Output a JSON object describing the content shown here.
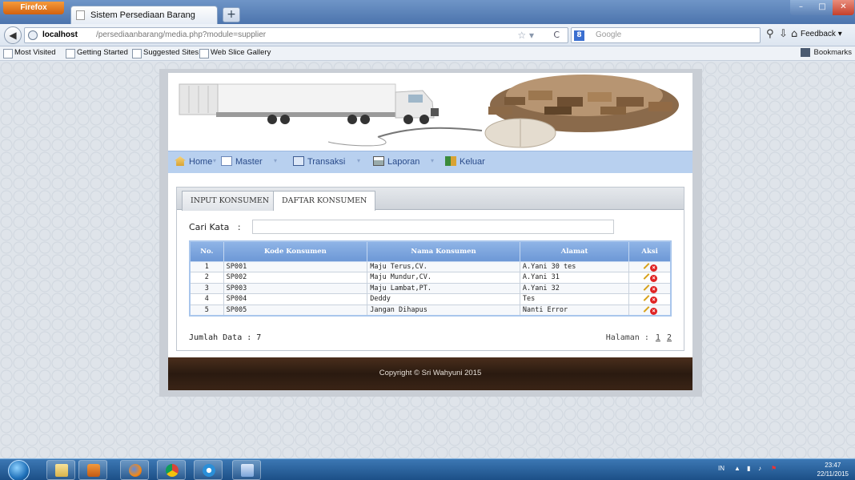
{
  "browser": {
    "app_button": "Firefox",
    "tab_title": "Sistem Persediaan Barang",
    "new_tab": "+",
    "url_host": "localhost",
    "url_path": "/persediaanbarang/media.php?module=supplier",
    "search_engine": "Google",
    "feedback": "Feedback",
    "bookmarks": [
      "Most Visited",
      "Getting Started",
      "Suggested Sites",
      "Web Slice Gallery"
    ],
    "bookmarks_menu": "Bookmarks"
  },
  "menu": {
    "items": [
      {
        "label": "Home",
        "icon": "home-icon"
      },
      {
        "label": "Master",
        "icon": "master-icon"
      },
      {
        "label": "Transaksi",
        "icon": "transaksi-icon"
      },
      {
        "label": "Laporan",
        "icon": "laporan-icon"
      },
      {
        "label": "Keluar",
        "icon": "keluar-icon"
      }
    ]
  },
  "tabs": {
    "input": "INPUT KONSUMEN",
    "daftar": "DAFTAR KONSUMEN"
  },
  "search": {
    "label": "Cari Kata",
    "colon": ":",
    "value": ""
  },
  "table": {
    "headers": [
      "No.",
      "Kode Konsumen",
      "Nama Konsumen",
      "Alamat",
      "Aksi"
    ],
    "rows": [
      {
        "no": "1",
        "kode": "SP001",
        "nama": "Maju Terus,CV.",
        "alamat": "A.Yani 30 tes"
      },
      {
        "no": "2",
        "kode": "SP002",
        "nama": "Maju Mundur,CV.",
        "alamat": "A.Yani 31"
      },
      {
        "no": "3",
        "kode": "SP003",
        "nama": "Maju Lambat,PT.",
        "alamat": "A.Yani 32"
      },
      {
        "no": "4",
        "kode": "SP004",
        "nama": "Deddy",
        "alamat": "Tes"
      },
      {
        "no": "5",
        "kode": "SP005",
        "nama": "Jangan Dihapus",
        "alamat": "Nanti Error"
      }
    ]
  },
  "summary": {
    "jumlah": "Jumlah Data : 7",
    "halaman_label": "Halaman :",
    "pages": [
      "1",
      "2"
    ]
  },
  "footer": {
    "copyright": "Copyright © Sri Wahyuni 2015"
  },
  "taskbar": {
    "tray_lang": "IN",
    "time": "23:47",
    "date": "22/11/2015"
  },
  "colors": {
    "menu_bg": "#b8d0ef",
    "table_header": "#6d98d6",
    "footer_bg": "#2a1a10"
  }
}
